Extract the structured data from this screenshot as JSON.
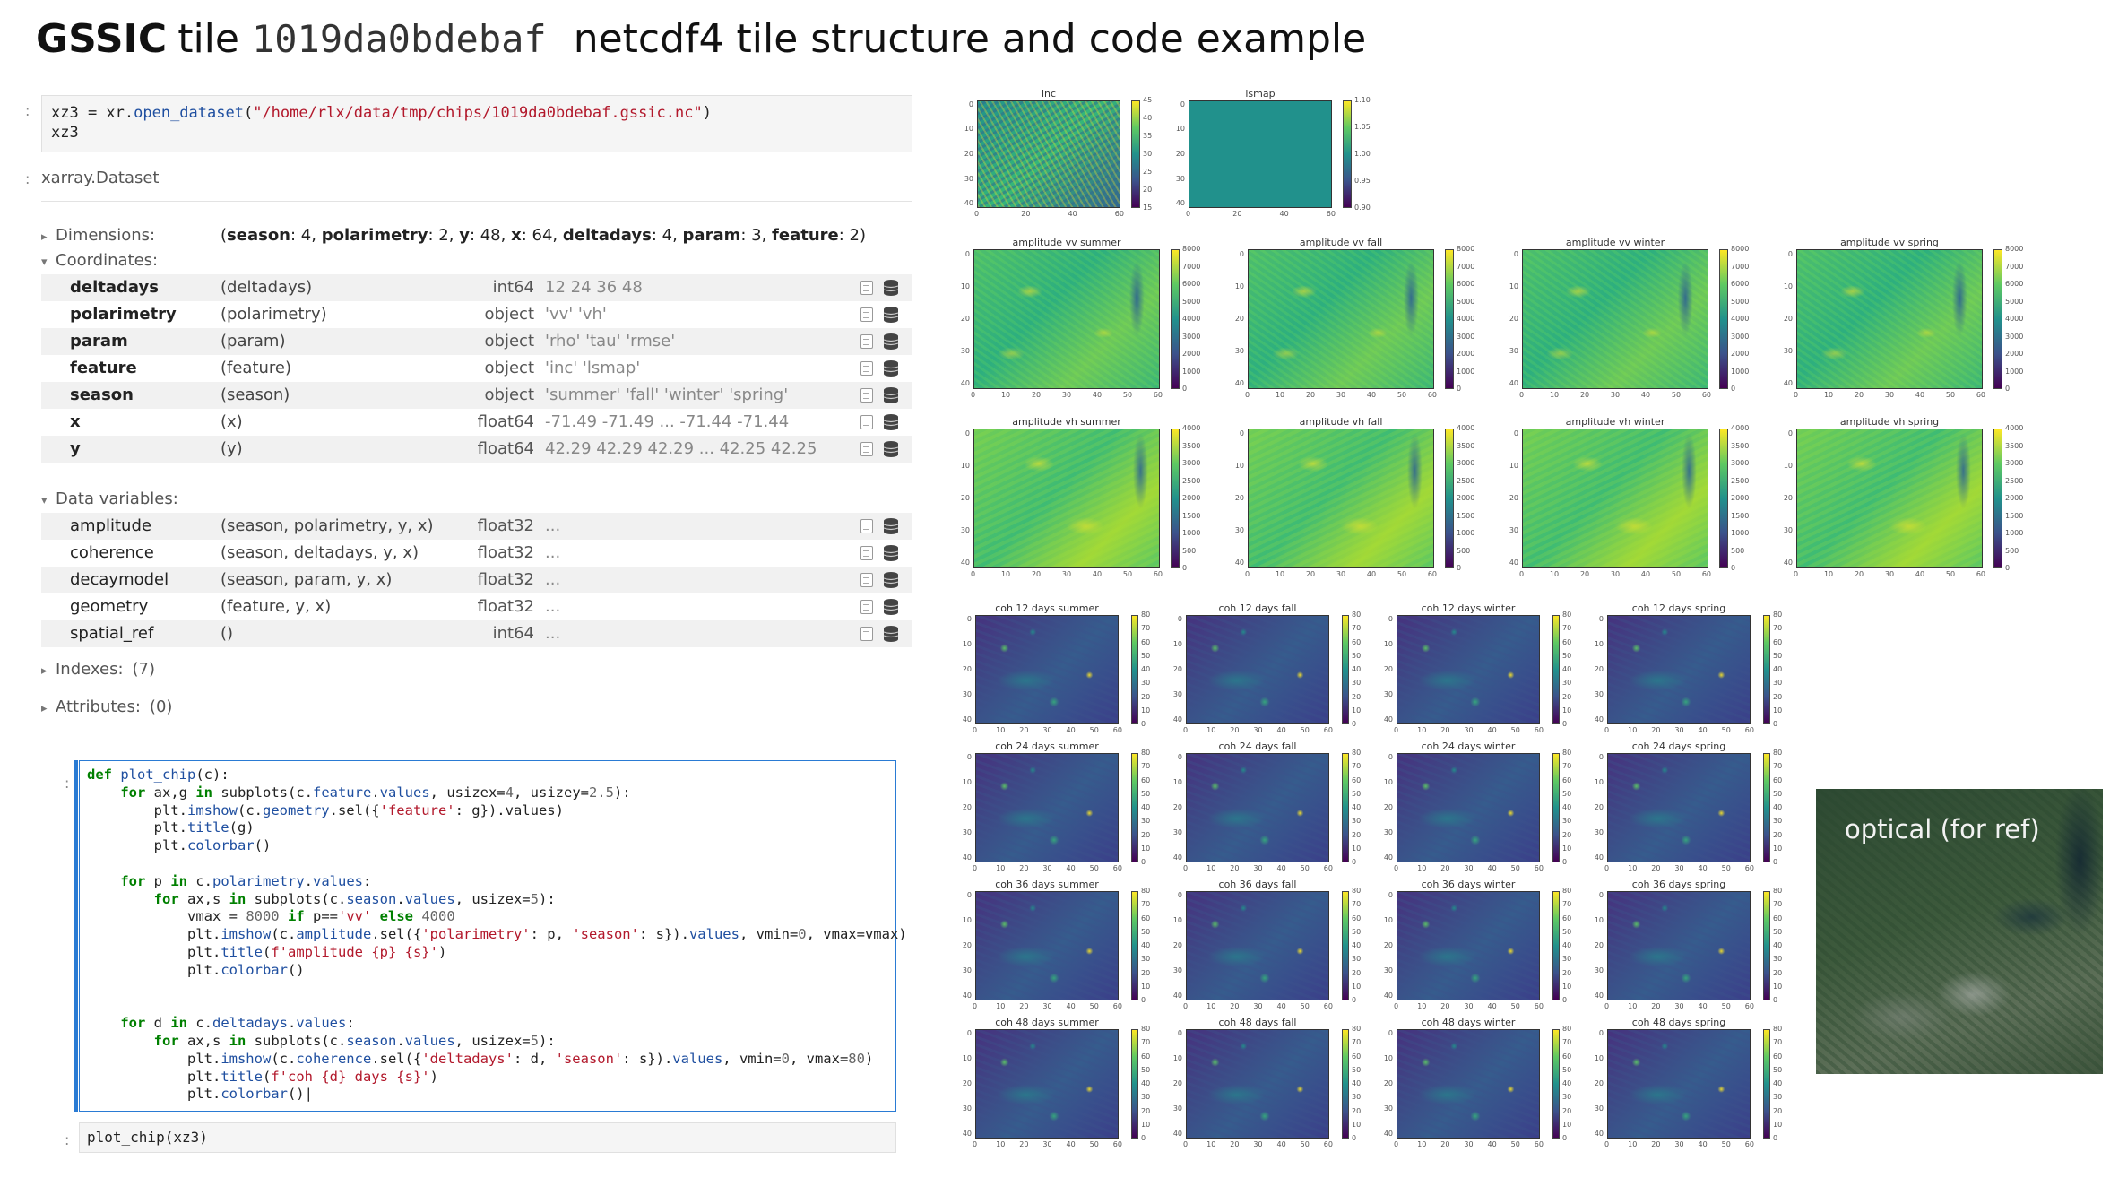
{
  "title": {
    "brand": "GSSIC",
    "tile_word": "tile",
    "tile_id": "1019da0bdebaf",
    "rest": "netcdf4 tile structure and code example"
  },
  "cell1": {
    "prompt": ":",
    "line1_var": "xz3 = xr.",
    "line1_fn": "open_dataset",
    "line1_str": "\"/home/rlx/data/tmp/chips/1019da0bdebaf.gssic.nc\"",
    "line1_close": ")",
    "line2": "xz3"
  },
  "output": {
    "prompt": ":",
    "header": "xarray.Dataset",
    "dimensions_label": "Dimensions:",
    "dims": [
      {
        "name": "season",
        "size": "4"
      },
      {
        "name": "polarimetry",
        "size": "2"
      },
      {
        "name": "y",
        "size": "48"
      },
      {
        "name": "x",
        "size": "64"
      },
      {
        "name": "deltadays",
        "size": "4"
      },
      {
        "name": "param",
        "size": "3"
      },
      {
        "name": "feature",
        "size": "2"
      }
    ],
    "coordinates_label": "Coordinates:",
    "coordinates": [
      {
        "name": "deltadays",
        "dims": "(deltadays)",
        "dtype": "int64",
        "preview": "12 24 36 48"
      },
      {
        "name": "polarimetry",
        "dims": "(polarimetry)",
        "dtype": "object",
        "preview": "'vv' 'vh'"
      },
      {
        "name": "param",
        "dims": "(param)",
        "dtype": "object",
        "preview": "'rho' 'tau' 'rmse'"
      },
      {
        "name": "feature",
        "dims": "(feature)",
        "dtype": "object",
        "preview": "'inc' 'lsmap'"
      },
      {
        "name": "season",
        "dims": "(season)",
        "dtype": "object",
        "preview": "'summer' 'fall' 'winter' 'spring'"
      },
      {
        "name": "x",
        "dims": "(x)",
        "dtype": "float64",
        "preview": "-71.49 -71.49 ... -71.44 -71.44"
      },
      {
        "name": "y",
        "dims": "(y)",
        "dtype": "float64",
        "preview": "42.29 42.29 42.29 ... 42.25 42.25"
      }
    ],
    "data_variables_label": "Data variables:",
    "data_variables": [
      {
        "name": "amplitude",
        "dims": "(season, polarimetry, y, x)",
        "dtype": "float32",
        "preview": "..."
      },
      {
        "name": "coherence",
        "dims": "(season, deltadays, y, x)",
        "dtype": "float32",
        "preview": "..."
      },
      {
        "name": "decaymodel",
        "dims": "(season, param, y, x)",
        "dtype": "float32",
        "preview": "..."
      },
      {
        "name": "geometry",
        "dims": "(feature, y, x)",
        "dtype": "float32",
        "preview": "..."
      },
      {
        "name": "spatial_ref",
        "dims": "()",
        "dtype": "int64",
        "preview": "..."
      }
    ],
    "indexes_label": "Indexes:",
    "indexes_count": "(7)",
    "attributes_label": "Attributes:",
    "attributes_count": "(0)"
  },
  "cell2": {
    "prompt": ":"
  },
  "cell3": {
    "prompt": ":",
    "code": "plot_chip(xz3)"
  },
  "plots": {
    "geometry": [
      {
        "title": "inc",
        "cbar_ticks": [
          "45",
          "40",
          "35",
          "30",
          "25",
          "20",
          "15"
        ]
      },
      {
        "title": "lsmap",
        "cbar_ticks": [
          "1.10",
          "1.05",
          "1.00",
          "0.95",
          "0.90"
        ]
      }
    ],
    "geometry_yticks": [
      "0",
      "10",
      "20",
      "30",
      "40"
    ],
    "geometry_xticks": [
      "0",
      "20",
      "40",
      "60"
    ],
    "amplitude_vv": [
      "amplitude vv summer",
      "amplitude vv fall",
      "amplitude vv winter",
      "amplitude vv spring"
    ],
    "amplitude_vv_cbar_ticks": [
      "8000",
      "7000",
      "6000",
      "5000",
      "4000",
      "3000",
      "2000",
      "1000",
      "0"
    ],
    "amplitude_vh": [
      "amplitude vh summer",
      "amplitude vh fall",
      "amplitude vh winter",
      "amplitude vh spring"
    ],
    "amplitude_vh_cbar_ticks": [
      "4000",
      "3500",
      "3000",
      "2500",
      "2000",
      "1500",
      "1000",
      "500",
      "0"
    ],
    "amp_yticks": [
      "0",
      "10",
      "20",
      "30",
      "40"
    ],
    "amp_xticks": [
      "0",
      "10",
      "20",
      "30",
      "40",
      "50",
      "60"
    ],
    "coherence_rows": [
      [
        "coh 12 days summer",
        "coh 12 days fall",
        "coh 12 days winter",
        "coh 12 days spring"
      ],
      [
        "coh 24 days summer",
        "coh 24 days fall",
        "coh 24 days winter",
        "coh 24 days spring"
      ],
      [
        "coh 36 days summer",
        "coh 36 days fall",
        "coh 36 days winter",
        "coh 36 days spring"
      ],
      [
        "coh 48 days summer",
        "coh 48 days fall",
        "coh 48 days winter",
        "coh 48 days spring"
      ]
    ],
    "coh_cbar_ticks": [
      "80",
      "70",
      "60",
      "50",
      "40",
      "30",
      "20",
      "10",
      "0"
    ],
    "coh_yticks": [
      "0",
      "10",
      "20",
      "30",
      "40"
    ],
    "coh_xticks": [
      "0",
      "10",
      "20",
      "30",
      "40",
      "50",
      "60"
    ]
  },
  "optical": {
    "label": "optical (for ref)"
  }
}
